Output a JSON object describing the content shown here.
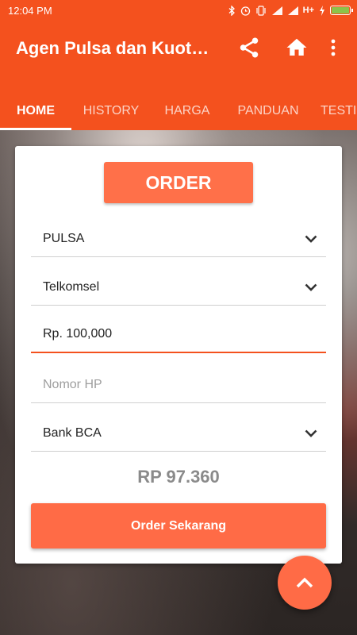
{
  "status_bar": {
    "time": "12:04 PM",
    "network": "H+",
    "icons": [
      "bluetooth-icon",
      "alarm-icon",
      "vibrate-icon",
      "signal-icon",
      "signal-icon",
      "charging-icon",
      "battery-icon"
    ]
  },
  "app_bar": {
    "title": "Agen Pulsa dan Kuot…",
    "actions": [
      "share-icon",
      "home-icon",
      "more-vert-icon"
    ]
  },
  "tabs": [
    {
      "label": "HOME",
      "active": true
    },
    {
      "label": "HISTORY",
      "active": false
    },
    {
      "label": "HARGA",
      "active": false
    },
    {
      "label": "PANDUAN",
      "active": false
    },
    {
      "label": "TESTI",
      "active": false
    }
  ],
  "form": {
    "order_button": "ORDER",
    "product_type": "PULSA",
    "operator": "Telkomsel",
    "nominal": "Rp. 100,000",
    "phone_placeholder": "Nomor HP",
    "payment": "Bank BCA",
    "total": "RP 97.360",
    "submit_button": "Order Sekarang"
  },
  "colors": {
    "primary": "#f4511e",
    "accent": "#ff6b46",
    "battery": "#8bc34a"
  }
}
